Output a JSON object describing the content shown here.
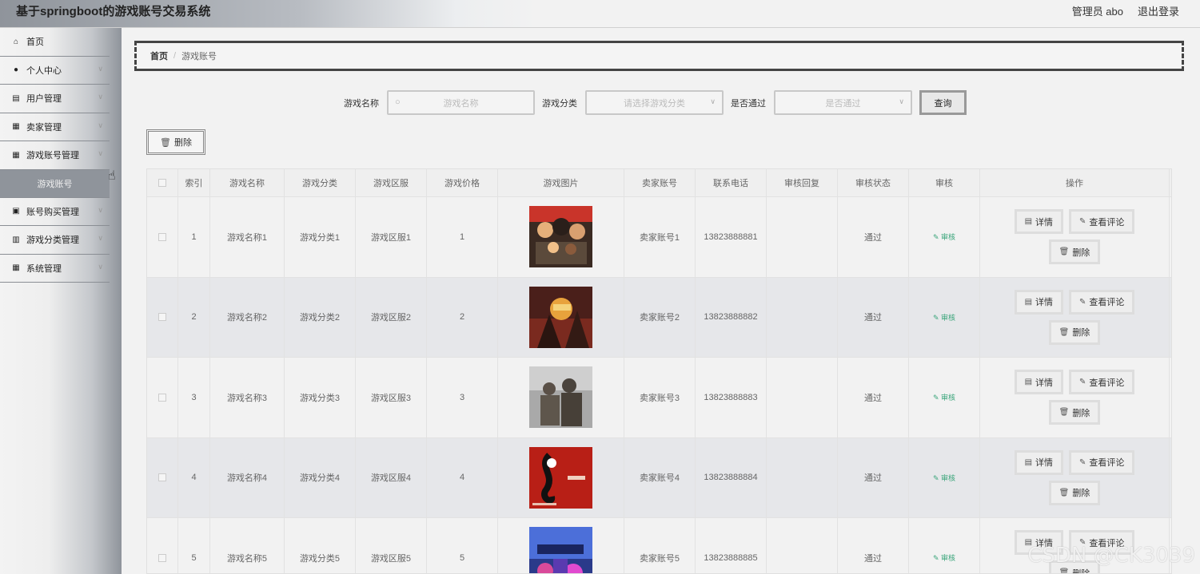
{
  "app": {
    "title": "基于springboot的游戏账号交易系统",
    "user": "管理员 abo",
    "logout": "退出登录"
  },
  "sidebar": {
    "items": [
      {
        "label": "首页",
        "icon": "home-icon",
        "glyph": "⌂",
        "chevron": false
      },
      {
        "label": "个人中心",
        "icon": "person-icon",
        "glyph": "●",
        "chevron": true
      },
      {
        "label": "用户管理",
        "icon": "user-doc-icon",
        "glyph": "▤",
        "chevron": true
      },
      {
        "label": "卖家管理",
        "icon": "grid-icon",
        "glyph": "▦",
        "chevron": true
      },
      {
        "label": "游戏账号管理",
        "icon": "grid-icon",
        "glyph": "▦",
        "chevron": true
      }
    ],
    "sub_item": "游戏账号",
    "items_after": [
      {
        "label": "账号购买管理",
        "icon": "clipboard-icon",
        "glyph": "▣",
        "chevron": true
      },
      {
        "label": "游戏分类管理",
        "icon": "list-grid-icon",
        "glyph": "▥",
        "chevron": true
      },
      {
        "label": "系统管理",
        "icon": "grid-icon",
        "glyph": "▦",
        "chevron": true
      }
    ]
  },
  "breadcrumb": {
    "home": "首页",
    "separator": "/",
    "current": "游戏账号"
  },
  "search": {
    "name_label": "游戏名称",
    "name_placeholder": "游戏名称",
    "category_label": "游戏分类",
    "category_placeholder": "请选择游戏分类",
    "pass_label": "是否通过",
    "pass_placeholder": "是否通过",
    "query_button": "查询"
  },
  "toolbar": {
    "delete_label": "删除"
  },
  "table": {
    "headers": [
      "",
      "索引",
      "游戏名称",
      "游戏分类",
      "游戏区服",
      "游戏价格",
      "游戏图片",
      "卖家账号",
      "联系电话",
      "审核回复",
      "审核状态",
      "审核",
      "操作"
    ],
    "rows": [
      {
        "index": "1",
        "name": "游戏名称1",
        "category": "游戏分类1",
        "server": "游戏区服1",
        "price": "1",
        "seller": "卖家账号1",
        "phone": "13823888881",
        "reply": "",
        "status": "通过",
        "audit": "审核"
      },
      {
        "index": "2",
        "name": "游戏名称2",
        "category": "游戏分类2",
        "server": "游戏区服2",
        "price": "2",
        "seller": "卖家账号2",
        "phone": "13823888882",
        "reply": "",
        "status": "通过",
        "audit": "审核"
      },
      {
        "index": "3",
        "name": "游戏名称3",
        "category": "游戏分类3",
        "server": "游戏区服3",
        "price": "3",
        "seller": "卖家账号3",
        "phone": "13823888883",
        "reply": "",
        "status": "通过",
        "audit": "审核"
      },
      {
        "index": "4",
        "name": "游戏名称4",
        "category": "游戏分类4",
        "server": "游戏区服4",
        "price": "4",
        "seller": "卖家账号4",
        "phone": "13823888884",
        "reply": "",
        "status": "通过",
        "audit": "审核"
      },
      {
        "index": "5",
        "name": "游戏名称5",
        "category": "游戏分类5",
        "server": "游戏区服5",
        "price": "5",
        "seller": "卖家账号5",
        "phone": "13823888885",
        "reply": "",
        "status": "通过",
        "audit": "审核"
      }
    ],
    "actions": {
      "detail": "详情",
      "comments": "查看评论",
      "delete": "删除"
    }
  },
  "watermark": "CSDN @CK3039",
  "colors": {
    "accent_green": "#3aa57a",
    "sidebar_active": "#8f949b"
  }
}
